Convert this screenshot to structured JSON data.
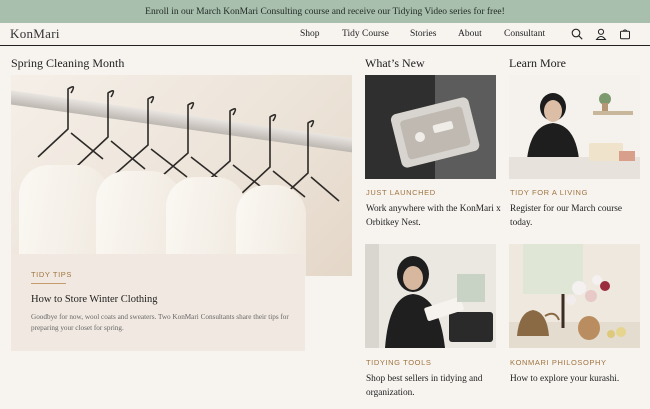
{
  "banner": {
    "text": "Enroll in our March KonMari Consulting course and receive our Tidying Video series for free!"
  },
  "nav": {
    "logo": "KonMari",
    "links": [
      "Shop",
      "Tidy Course",
      "Stories",
      "About",
      "Consultant"
    ],
    "icons": [
      "search-icon",
      "account-icon",
      "cart-icon"
    ]
  },
  "featured": {
    "section_title": "Spring Cleaning Month",
    "kicker": "TIDY TIPS",
    "title": "How to Store Winter Clothing",
    "description": "Goodbye for now, wool coats and sweaters. Two KonMari Consultants share their tips for preparing your closet for spring."
  },
  "whats_new": {
    "section_title": "What’s New",
    "items": [
      {
        "kicker": "JUST LAUNCHED",
        "title": "Work anywhere with the KonMari x Orbitkey Nest."
      },
      {
        "kicker": "TIDYING TOOLS",
        "title": "Shop best sellers in tidying and organization."
      }
    ]
  },
  "learn_more": {
    "section_title": "Learn More",
    "items": [
      {
        "kicker": "TIDY FOR A LIVING",
        "title": "Register for our March course today."
      },
      {
        "kicker": "KONMARI PHILOSOPHY",
        "title": "How to explore your kurashi."
      }
    ]
  },
  "colors": {
    "banner": "#a9bfae",
    "accent": "#a0743f",
    "background": "#f7f4f0",
    "card": "#f1e9e1"
  }
}
